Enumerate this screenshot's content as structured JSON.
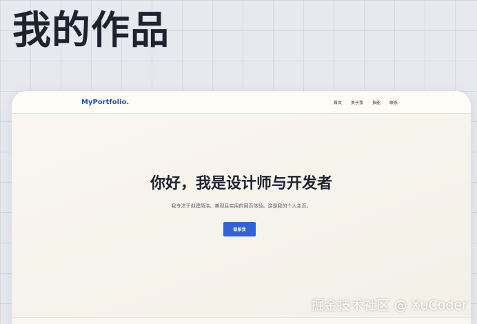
{
  "page_heading": "我的作品",
  "preview": {
    "brand": "MyPortfolio.",
    "nav": [
      "首页",
      "关于我",
      "技能",
      "联系"
    ],
    "hero_title": "你好，我是设计师与开发者",
    "hero_subtitle": "我专注于创建简洁、美观且实用的网页体验。这是我的个人主页。",
    "cta_label": "联系我"
  },
  "watermark": "掘金技术社区 @ XuCoder",
  "colors": {
    "accent": "#2f62d9",
    "brand": "#1f4fa8",
    "heading": "#1f2330"
  }
}
